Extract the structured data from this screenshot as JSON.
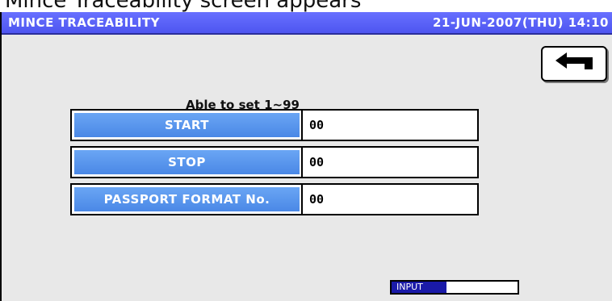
{
  "caption": "Mince Traceability screen appears",
  "header": {
    "title": "MINCE TRACEABILITY",
    "datetime": "21-JUN-2007(THU) 14:10"
  },
  "hint": "Able to set 1~99",
  "fields": [
    {
      "label": "START",
      "value": "00"
    },
    {
      "label": "STOP",
      "value": "00"
    },
    {
      "label": "PASSPORT FORMAT No.",
      "value": "00"
    }
  ],
  "status": {
    "mode": "INPUT"
  },
  "icons": {
    "back": "return-arrow-icon"
  },
  "colors": {
    "titlebar": "#5a60f8",
    "field_label": "#5a96ee",
    "background": "#e8e8e8",
    "input_tag": "#1a1aa8"
  }
}
